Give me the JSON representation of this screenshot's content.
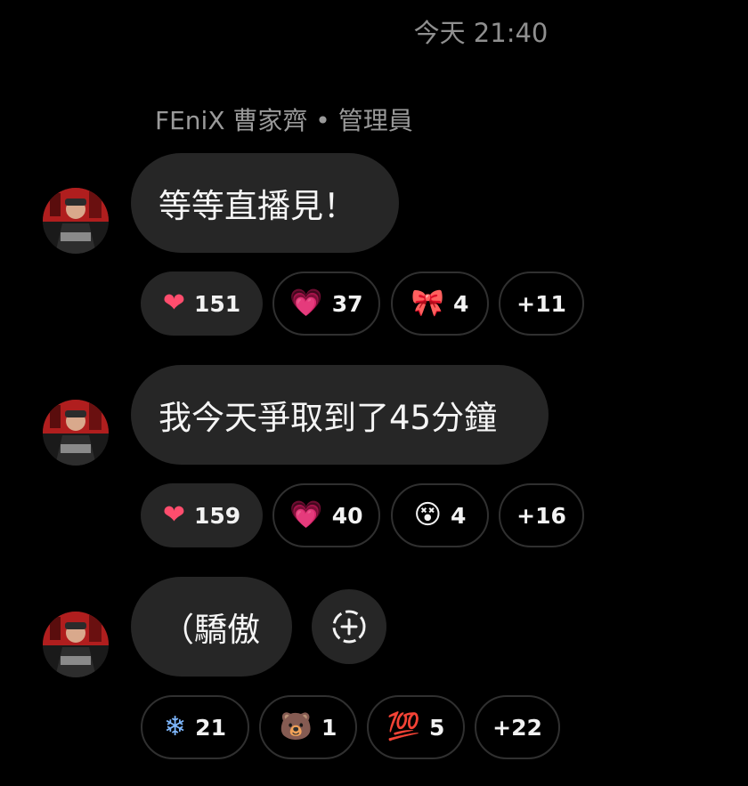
{
  "header": {
    "timestamp": "今天 21:40"
  },
  "sender": {
    "label": "FEniX 曹家齊 • 管理員"
  },
  "messages": [
    {
      "text": "等等直播見！",
      "reactions": [
        {
          "emoji": "❤",
          "icon": "heart-icon",
          "count": "151",
          "active": true
        },
        {
          "emoji": "💗",
          "icon": "pink-heart-icon",
          "count": "37",
          "active": false
        },
        {
          "emoji": "🎀",
          "icon": "ribbon-icon",
          "count": "4",
          "active": false
        }
      ],
      "more": "+11"
    },
    {
      "text": "我今天爭取到了45分鐘",
      "reactions": [
        {
          "emoji": "❤",
          "icon": "heart-icon",
          "count": "159",
          "active": true
        },
        {
          "emoji": "💗",
          "icon": "pink-heart-icon",
          "count": "40",
          "active": false
        },
        {
          "emoji": "😵",
          "icon": "dizzy-face-icon",
          "count": "4",
          "active": false
        }
      ],
      "more": "+16"
    },
    {
      "text": "（驕傲",
      "reactions": [
        {
          "emoji": "❄",
          "icon": "snowflake-icon",
          "count": "21",
          "active": false
        },
        {
          "emoji": "🐻",
          "icon": "bear-icon",
          "count": "1",
          "active": false
        },
        {
          "emoji": "💯",
          "icon": "hundred-points-icon",
          "count": "5",
          "active": false
        }
      ],
      "more": "+22"
    }
  ],
  "colors": {
    "background": "#000000",
    "bubble": "#262626",
    "chip_border": "#303030",
    "meta_text": "#8f8f8f"
  }
}
